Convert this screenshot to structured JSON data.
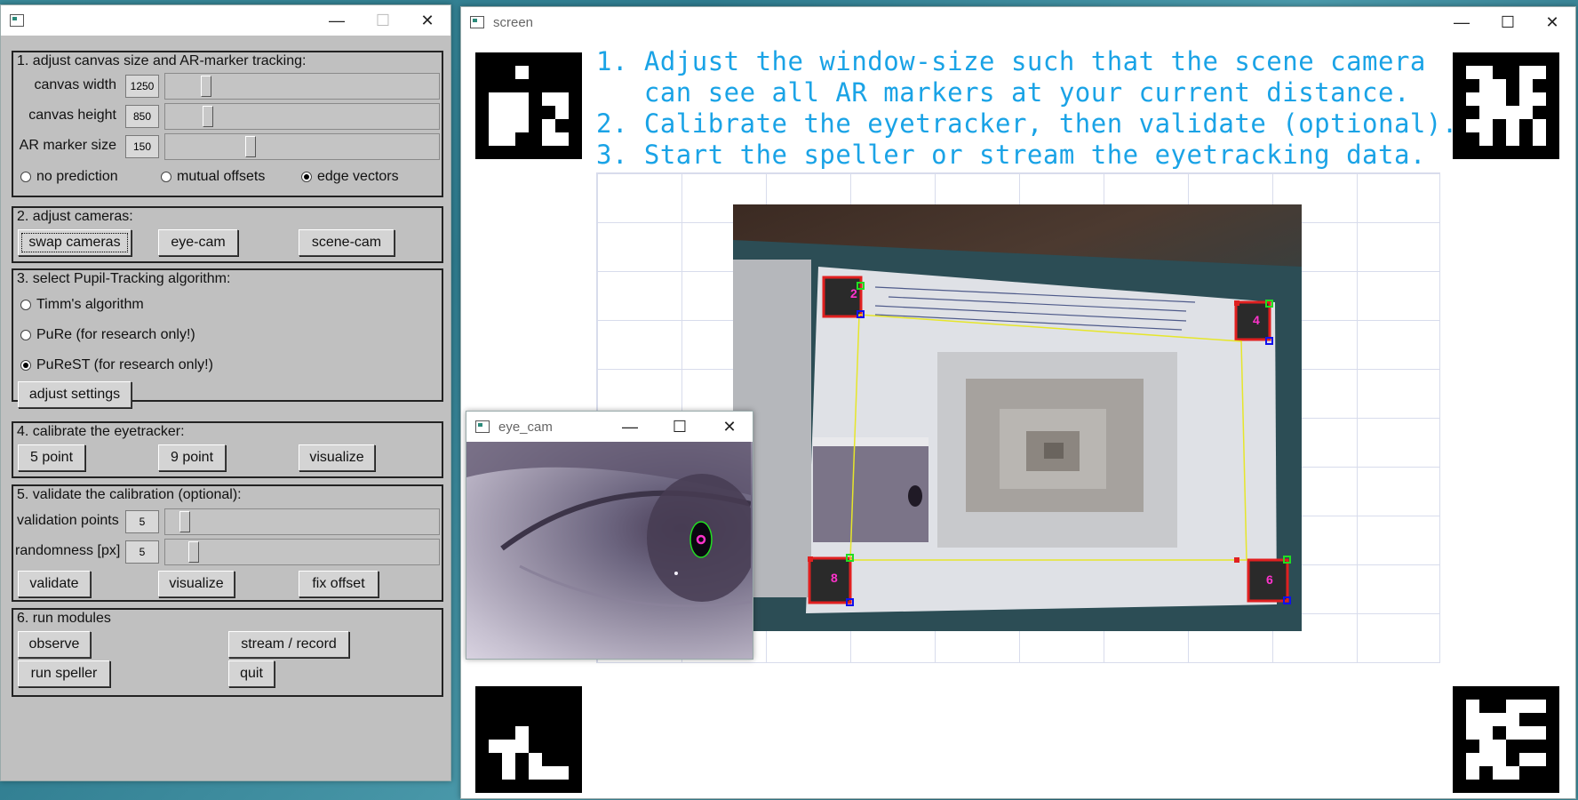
{
  "control_window": {
    "title": "",
    "controls": {
      "minimize": "—",
      "maximize": "☐",
      "close": "✕"
    },
    "sections": {
      "s1": {
        "title": "1. adjust canvas size and AR-marker tracking:",
        "canvas_width_label": "canvas width",
        "canvas_width_value": "1250",
        "canvas_height_label": "canvas height",
        "canvas_height_value": "850",
        "marker_size_label": "AR marker size",
        "marker_size_value": "150",
        "radio_none": "no prediction",
        "radio_mutual": "mutual offsets",
        "radio_edge": "edge vectors",
        "selected_radio": "edge vectors"
      },
      "s2": {
        "title": "2. adjust cameras:",
        "swap": "swap cameras",
        "eye_cam": "eye-cam",
        "scene_cam": "scene-cam"
      },
      "s3": {
        "title": "3. select Pupil-Tracking algorithm:",
        "timm": "Timm's algorithm",
        "pure": "PuRe (for research only!)",
        "purest": "PuReST (for research only!)",
        "selected": "PuReST (for research only!)",
        "adjust": "adjust settings"
      },
      "s4": {
        "title": "4. calibrate the eyetracker:",
        "five": "5 point",
        "nine": "9 point",
        "visualize": "visualize"
      },
      "s5": {
        "title": "5. validate the calibration (optional):",
        "points_label": "validation points",
        "points_value": "5",
        "random_label": "randomness [px]",
        "random_value": "5",
        "validate": "validate",
        "visualize": "visualize",
        "fix_offset": "fix offset"
      },
      "s6": {
        "title": "6. run modules",
        "observe": "observe",
        "stream": "stream / record",
        "speller": "run speller",
        "quit": "quit"
      }
    }
  },
  "screen_window": {
    "title": "screen",
    "controls": {
      "minimize": "—",
      "maximize": "☐",
      "close": "✕"
    },
    "instructions": [
      "1. Adjust the window-size such that the scene camera",
      "   can see all AR markers at your current distance.",
      "2. Calibrate the eyetracker, then validate (optional).",
      "3. Start the speller or stream the eyetracking data."
    ],
    "marker_ids": [
      "2",
      "4",
      "8",
      "6"
    ]
  },
  "eye_window": {
    "title": "eye_cam",
    "controls": {
      "minimize": "—",
      "maximize": "☐",
      "close": "✕"
    }
  },
  "colors": {
    "instruction_text": "#1aa3e6",
    "panel_bg": "#c0c0c0",
    "marker_red": "#e02020",
    "marker_green": "#22dd22",
    "marker_blue": "#1010ee",
    "overlay_yellow": "#e6e62a",
    "pupil_magenta": "#ff33cc"
  }
}
